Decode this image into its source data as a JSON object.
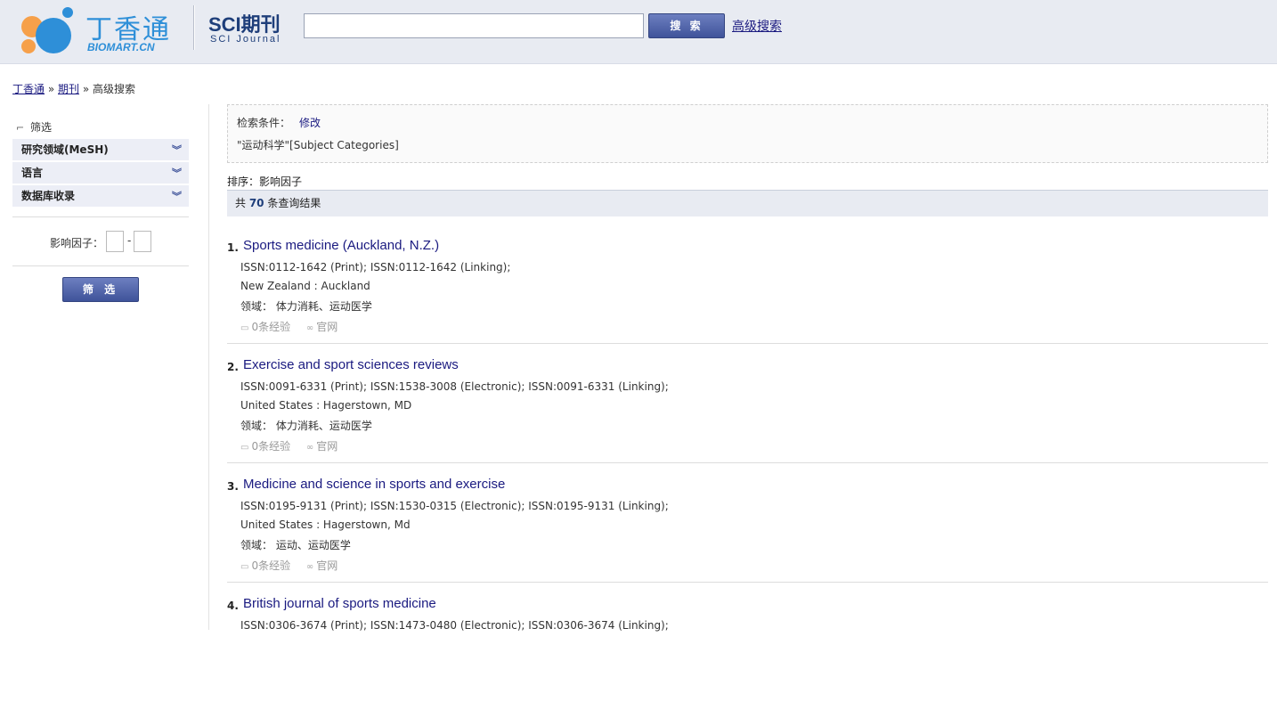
{
  "header": {
    "logo_cn": "丁香通",
    "logo_en": "BIOMART.CN",
    "section_title": "SCI期刊",
    "section_subtitle": "SCI Journal",
    "search_value": "",
    "search_button": "搜 索",
    "advanced_link": "高级搜索"
  },
  "breadcrumb": {
    "home": "丁香通",
    "sep1": " » ",
    "journals": "期刊",
    "sep2": " » ",
    "current": "高级搜索"
  },
  "sidebar": {
    "filter_title": "筛选",
    "facets": [
      {
        "label": "研究领域(MeSH)"
      },
      {
        "label": "语言"
      },
      {
        "label": "数据库收录"
      }
    ],
    "impact_factor_label": "影响因子：",
    "range_dash": "-",
    "filter_button": "筛 选"
  },
  "criteria": {
    "label": "检索条件：",
    "edit": "修改",
    "query": "\"运动科学\"[Subject Categories]"
  },
  "sort": {
    "label": "排序：",
    "value": "影响因子"
  },
  "total": {
    "prefix": "共 ",
    "count": "70",
    "suffix": " 条查询结果"
  },
  "results": [
    {
      "num": "1.",
      "title": "Sports medicine (Auckland, N.Z.)",
      "issn": "ISSN:0112-1642 (Print); ISSN:0112-1642 (Linking);",
      "location": "New Zealand : Auckland",
      "field": "领域： 体力消耗、运动医学",
      "experience": "0条经验",
      "website": "官网"
    },
    {
      "num": "2.",
      "title": "Exercise and sport sciences reviews",
      "issn": "ISSN:0091-6331 (Print); ISSN:1538-3008 (Electronic); ISSN:0091-6331 (Linking);",
      "location": "United States : Hagerstown, MD",
      "field": "领域： 体力消耗、运动医学",
      "experience": "0条经验",
      "website": "官网"
    },
    {
      "num": "3.",
      "title": "Medicine and science in sports and exercise",
      "issn": "ISSN:0195-9131 (Print); ISSN:1530-0315 (Electronic); ISSN:0195-9131 (Linking);",
      "location": "United States : Hagerstown, Md",
      "field": "领域： 运动、运动医学",
      "experience": "0条经验",
      "website": "官网"
    },
    {
      "num": "4.",
      "title": "British journal of sports medicine",
      "issn": "ISSN:0306-3674 (Print); ISSN:1473-0480 (Electronic); ISSN:0306-3674 (Linking);",
      "location": "",
      "field": "",
      "experience": "",
      "website": ""
    }
  ],
  "icons": {
    "comment": "comment-icon",
    "link": "link-icon",
    "chevron": "double-chevron-down-icon"
  }
}
